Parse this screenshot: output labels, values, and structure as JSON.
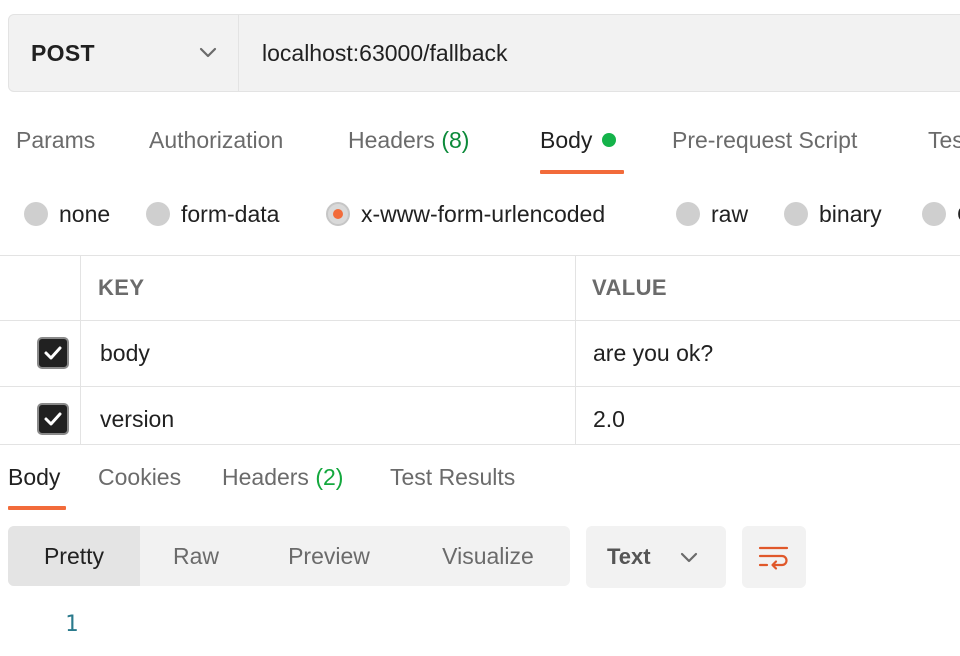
{
  "request": {
    "method": "POST",
    "url": "localhost:63000/fallback"
  },
  "request_tabs": {
    "params": "Params",
    "authorization": "Authorization",
    "headers": "Headers",
    "headers_count": "(8)",
    "body": "Body",
    "pre_request": "Pre-request Script",
    "tests_partial": "Tes"
  },
  "body_types": {
    "none": "none",
    "form_data": "form-data",
    "urlencoded": "x-www-form-urlencoded",
    "raw": "raw",
    "binary": "binary",
    "graphql_partial": "G",
    "selected": "x-www-form-urlencoded"
  },
  "params_table": {
    "headers": {
      "key": "KEY",
      "value": "VALUE"
    },
    "rows": [
      {
        "checked": true,
        "key": "body",
        "value": "are you ok?"
      },
      {
        "checked": true,
        "key": "version",
        "value": "2.0"
      }
    ]
  },
  "response_tabs": {
    "body": "Body",
    "cookies": "Cookies",
    "headers": "Headers",
    "headers_count": "(2)",
    "test_results": "Test Results"
  },
  "view_modes": {
    "pretty": "Pretty",
    "raw": "Raw",
    "preview": "Preview",
    "visualize": "Visualize",
    "active": "Pretty"
  },
  "format": {
    "selected": "Text"
  },
  "editor": {
    "line_numbers": [
      "1"
    ]
  },
  "colors": {
    "accent": "#f26b3a",
    "status_green": "#14b34a",
    "count_green": "#0c8a3a",
    "line_number": "#2a7a8c"
  },
  "icons": {
    "method_dropdown": "chevron-down-icon",
    "format_dropdown": "chevron-down-icon",
    "wrap": "wrap-lines-icon",
    "check": "checkmark-icon"
  }
}
